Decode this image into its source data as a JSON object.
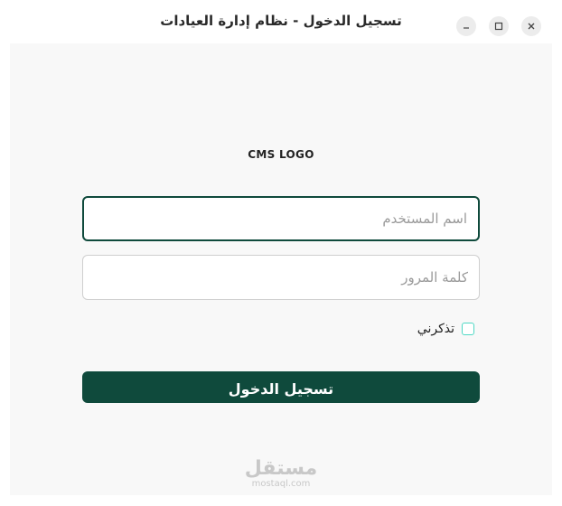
{
  "window": {
    "title": "تسجيل الدخول - نظام إدارة العيادات",
    "controls": {
      "minimize_icon": "minimize-icon",
      "maximize_icon": "maximize-icon",
      "close_icon": "close-icon"
    }
  },
  "login": {
    "logo_text": "CMS LOGO",
    "username": {
      "placeholder": "اسم المستخدم",
      "value": ""
    },
    "password": {
      "placeholder": "كلمة المرور",
      "value": ""
    },
    "remember_label": "تذكرني",
    "remember_checked": false,
    "submit_label": "تسجيل الدخول"
  },
  "watermark": {
    "name": "مستقل",
    "url": "mostaql.com"
  },
  "colors": {
    "primary": "#0f4a3c",
    "checkbox_border": "#4fd8c4",
    "content_bg": "#f8f8f8"
  }
}
